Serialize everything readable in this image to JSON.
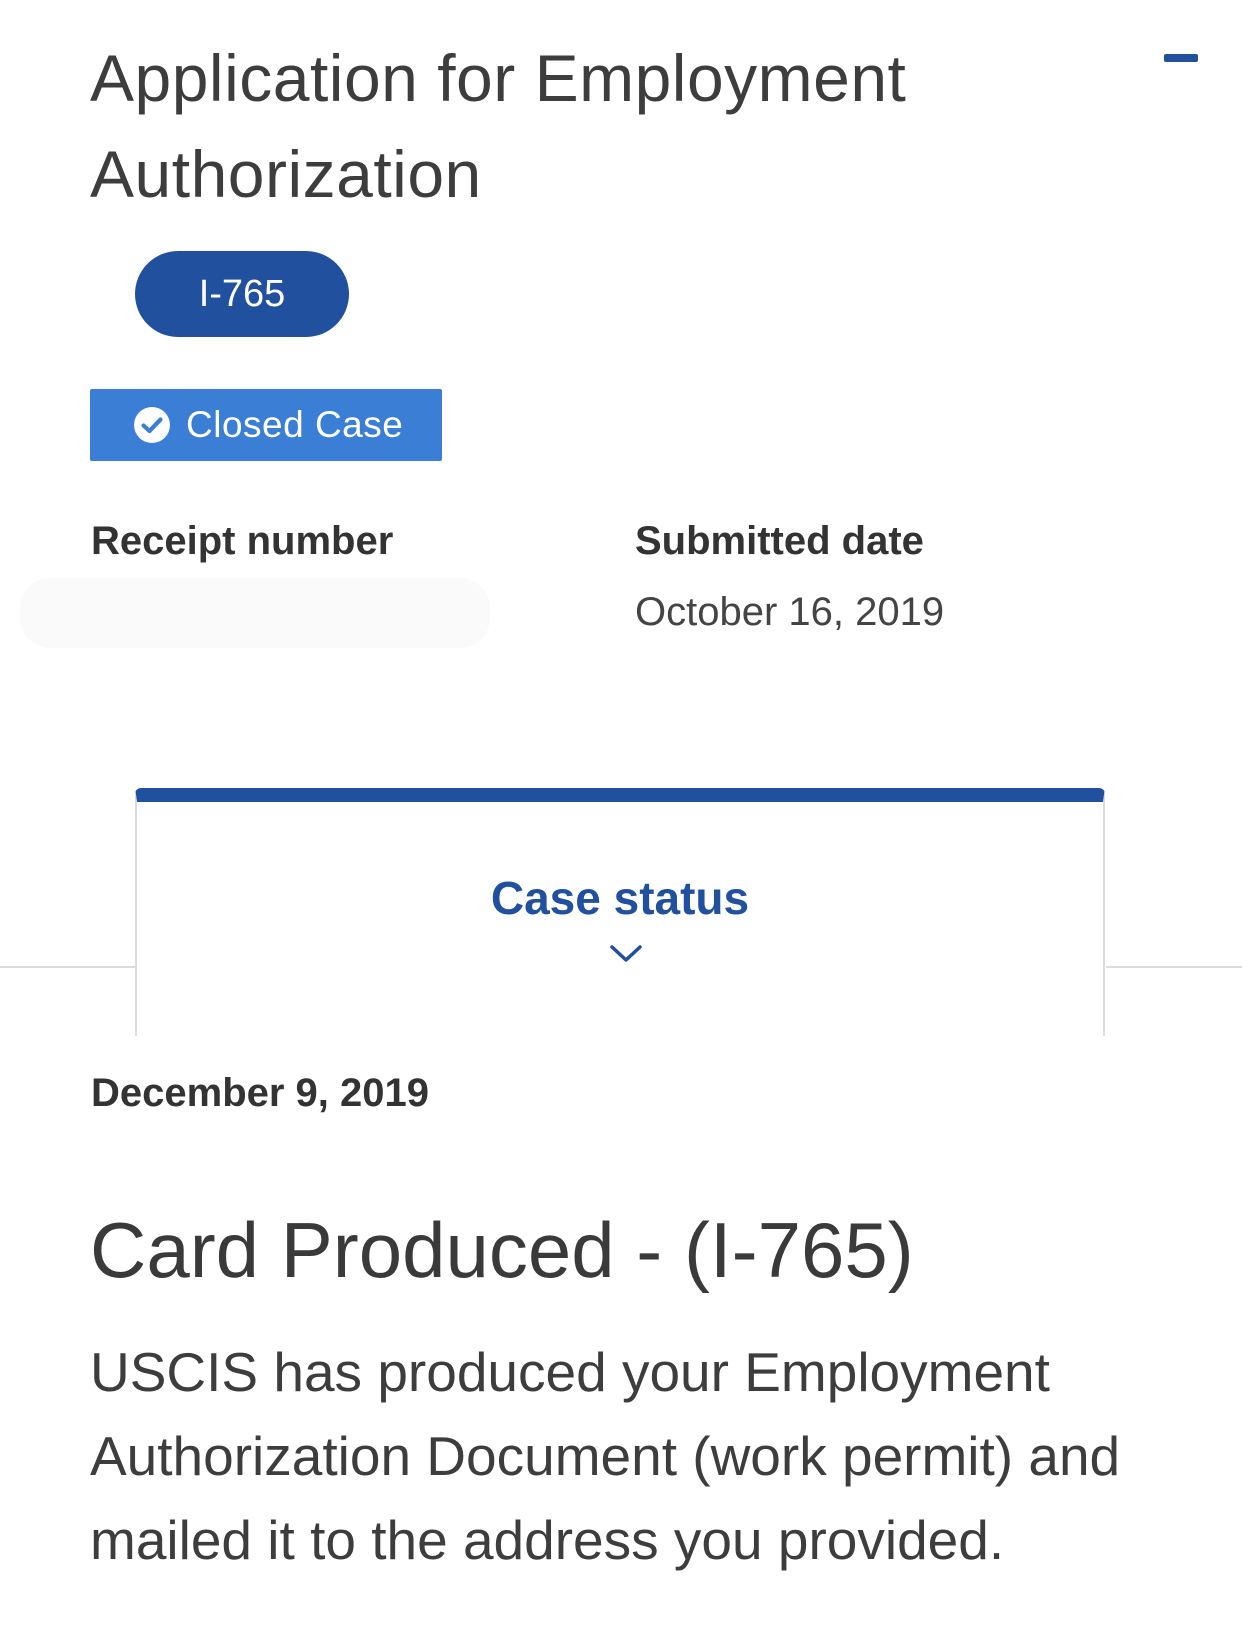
{
  "header": {
    "title": "Application for Employment Authorization",
    "collapse_icon": "minus-icon",
    "form_pill": "I-765",
    "closed_badge": {
      "label": "Closed Case",
      "icon": "check-circle-icon"
    }
  },
  "details": {
    "receipt_label": "Receipt number",
    "receipt_value": "",
    "submitted_label": "Submitted date",
    "submitted_value": "October 16, 2019"
  },
  "tab": {
    "label": "Case status",
    "icon": "chevron-down-icon"
  },
  "status": {
    "date": "December 9, 2019",
    "heading": "Card Produced - (I-765)",
    "body": "USCIS has produced your Employment Authorization Document (work permit) and mailed it to the address you provided."
  },
  "colors": {
    "primary": "#20509e",
    "badge": "#3a7fd5",
    "text": "#3d3d3d",
    "divider": "#dcdcdc"
  }
}
